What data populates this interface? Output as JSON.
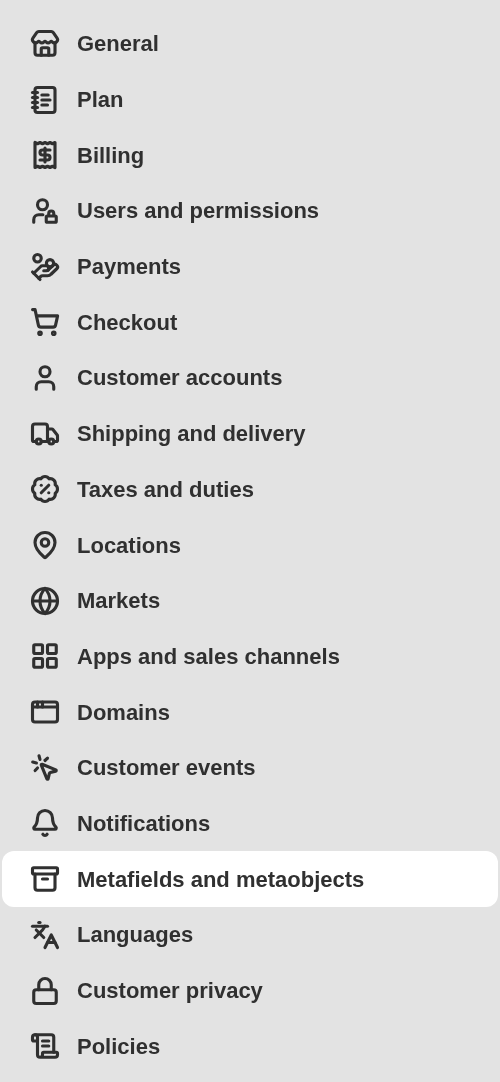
{
  "menu": [
    {
      "label": "General",
      "selected": false
    },
    {
      "label": "Plan",
      "selected": false
    },
    {
      "label": "Billing",
      "selected": false
    },
    {
      "label": "Users and permissions",
      "selected": false
    },
    {
      "label": "Payments",
      "selected": false
    },
    {
      "label": "Checkout",
      "selected": false
    },
    {
      "label": "Customer accounts",
      "selected": false
    },
    {
      "label": "Shipping and delivery",
      "selected": false
    },
    {
      "label": "Taxes and duties",
      "selected": false
    },
    {
      "label": "Locations",
      "selected": false
    },
    {
      "label": "Markets",
      "selected": false
    },
    {
      "label": "Apps and sales channels",
      "selected": false
    },
    {
      "label": "Domains",
      "selected": false
    },
    {
      "label": "Customer events",
      "selected": false
    },
    {
      "label": "Notifications",
      "selected": false
    },
    {
      "label": "Metafields and metaobjects",
      "selected": true
    },
    {
      "label": "Languages",
      "selected": false
    },
    {
      "label": "Customer privacy",
      "selected": false
    },
    {
      "label": "Policies",
      "selected": false
    }
  ]
}
